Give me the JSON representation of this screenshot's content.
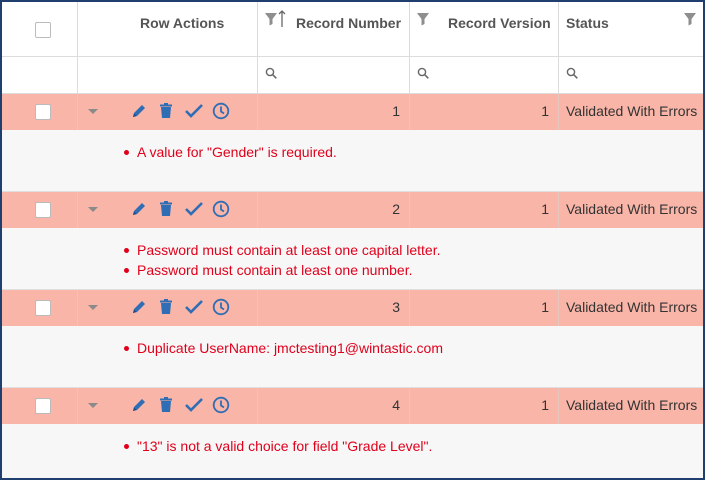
{
  "columns": {
    "row_actions": "Row Actions",
    "record_number": "Record Number",
    "record_version": "Record Version",
    "status": "Status"
  },
  "colors": {
    "error_row_bg": "#f9b5a8",
    "error_text": "#e0001b",
    "action_icon": "#2f6db5"
  },
  "icons": [
    "pencil-icon",
    "trash-icon",
    "check-icon",
    "clock-icon",
    "filter-icon",
    "search-icon",
    "sort-icon"
  ],
  "rows": [
    {
      "record_number": "1",
      "record_version": "1",
      "status": "Validated With Errors",
      "errors": [
        "A value for \"Gender\" is required."
      ]
    },
    {
      "record_number": "2",
      "record_version": "1",
      "status": "Validated With Errors",
      "errors": [
        "Password must contain at least one capital letter.",
        "Password must contain at least one number."
      ]
    },
    {
      "record_number": "3",
      "record_version": "1",
      "status": "Validated With Errors",
      "errors": [
        "Duplicate UserName: jmctesting1@wintastic.com"
      ]
    },
    {
      "record_number": "4",
      "record_version": "1",
      "status": "Validated With Errors",
      "errors": [
        "\"13\" is not a valid choice for field \"Grade Level\"."
      ]
    }
  ]
}
